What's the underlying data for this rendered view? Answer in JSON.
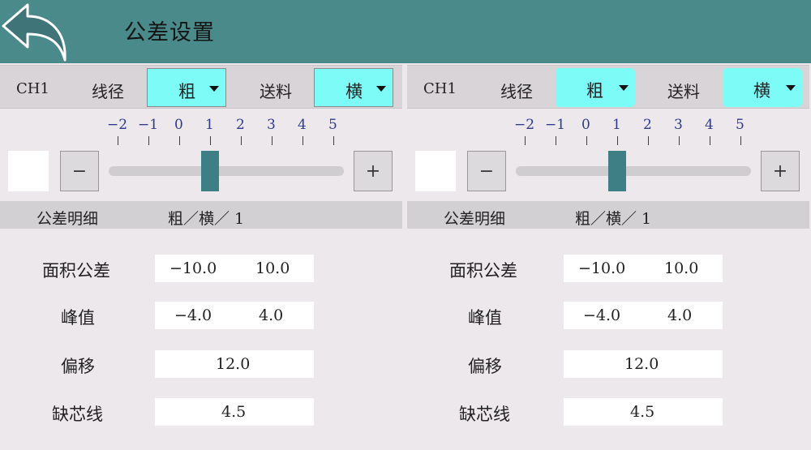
{
  "header": {
    "title": "公差设置",
    "back_icon": "back-arrow-icon"
  },
  "colors": {
    "header_bg": "#4a8a8a",
    "select_bg": "#7dfcf7",
    "slider_handle": "#3e7f85",
    "tick_color": "#2d3a8e"
  },
  "panels": [
    {
      "channel": "CH1",
      "wire_label": "线径",
      "wire_value": "粗",
      "feed_label": "送料",
      "feed_value": "横",
      "ticks": [
        "−2",
        "−1",
        "0",
        "1",
        "2",
        "3",
        "4",
        "5"
      ],
      "slider_value": 1,
      "minus_label": "−",
      "plus_label": "+",
      "detail_title": "公差明细",
      "detail_value": "粗／横／ 1",
      "area_label": "面积公差",
      "area_min": "−10.0",
      "area_max": "10.0",
      "peak_label": "峰值",
      "peak_min": "−4.0",
      "peak_max": "4.0",
      "offset_label": "偏移",
      "offset_value": "12.0",
      "missing_label": "缺芯线",
      "missing_value": "4.5"
    },
    {
      "channel": "CH1",
      "wire_label": "线径",
      "wire_value": "粗",
      "feed_label": "送料",
      "feed_value": "横",
      "ticks": [
        "−2",
        "−1",
        "0",
        "1",
        "2",
        "3",
        "4",
        "5"
      ],
      "slider_value": 1,
      "minus_label": "−",
      "plus_label": "+",
      "detail_title": "公差明细",
      "detail_value": "粗／横／ 1",
      "area_label": "面积公差",
      "area_min": "−10.0",
      "area_max": "10.0",
      "peak_label": "峰值",
      "peak_min": "−4.0",
      "peak_max": "4.0",
      "offset_label": "偏移",
      "offset_value": "12.0",
      "missing_label": "缺芯线",
      "missing_value": "4.5"
    }
  ]
}
